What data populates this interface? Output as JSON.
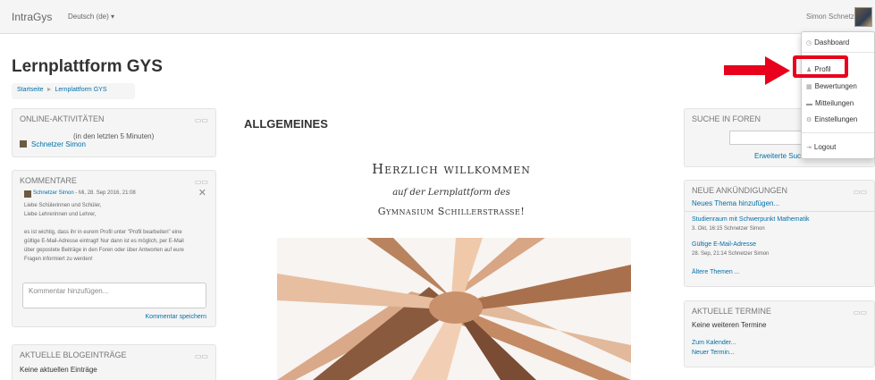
{
  "navbar": {
    "brand": "IntraGys",
    "language": "Deutsch (de) ▾",
    "user_name": "Simon Schnetzer"
  },
  "page": {
    "title": "Lernplattform GYS",
    "breadcrumb": [
      "Startseite",
      "Lernplattform GYS"
    ]
  },
  "online_block": {
    "title": "ONLINE-AKTIVITÄTEN",
    "subtitle": "(in den letzten 5 Minuten)",
    "user": "Schnetzer Simon"
  },
  "comments_block": {
    "title": "KOMMENTARE",
    "comment_author": "Schnetzer Simon",
    "comment_meta": " - Mi, 28. Sep 2016, 21:08",
    "lines": [
      "Liebe Schülerinnen und Schüler,",
      "Liebe Lehrerinnen und Lehrer,",
      "",
      "es ist wichtig, dass ihr in eurem Profil unter \"Profil bearbeiten\" eine",
      "gültige E-Mail-Adresse eintragt! Nur dann ist es möglich, per E-Mail",
      "über gepostete Beiträge in den Foren oder über Antworten auf eure",
      "Fragen informiert zu werden!"
    ],
    "placeholder": "Kommentar hinzufügen...",
    "save_label": "Kommentar speichern"
  },
  "blog_block": {
    "title": "AKTUELLE BLOGEINTRÄGE",
    "empty": "Keine aktuellen Einträge"
  },
  "main": {
    "heading": "ALLGEMEINES",
    "welcome_line1": "Herzlich willkommen",
    "welcome_line2": "auf der Lernplattform des",
    "welcome_line3": "Gymnasium Schillerstraße!"
  },
  "search_block": {
    "title": "SUCHE IN FOREN",
    "advanced": "Erweiterte Such"
  },
  "news_block": {
    "title": "NEUE ANKÜNDIGUNGEN",
    "add_topic": "Neues Thema hinzufügen...",
    "items": [
      {
        "title": "Studienraum mit Schwerpunkt Mathematik",
        "meta": "3. Okt, 16:15 Schnetzer Simon"
      },
      {
        "title": "Gültige E-Mail-Adresse",
        "meta": "28. Sep, 21:14 Schnetzer Simon"
      }
    ],
    "older": "Ältere Themen ..."
  },
  "events_block": {
    "title": "AKTUELLE TERMINE",
    "empty": "Keine weiteren Termine",
    "calendar": "Zum Kalender...",
    "new_event": "Neuer Termin..."
  },
  "user_menu": {
    "items": [
      {
        "label": "Dashboard",
        "icon": "dashboard-icon"
      },
      {
        "label": "Profil",
        "icon": "user-icon"
      },
      {
        "label": "Bewertungen",
        "icon": "grades-icon"
      },
      {
        "label": "Mitteilungen",
        "icon": "messages-icon"
      },
      {
        "label": "Einstellungen",
        "icon": "settings-icon"
      },
      {
        "label": "Logout",
        "icon": "logout-icon"
      }
    ]
  },
  "colors": {
    "link": "#0070a8",
    "highlight": "#e8001c"
  }
}
